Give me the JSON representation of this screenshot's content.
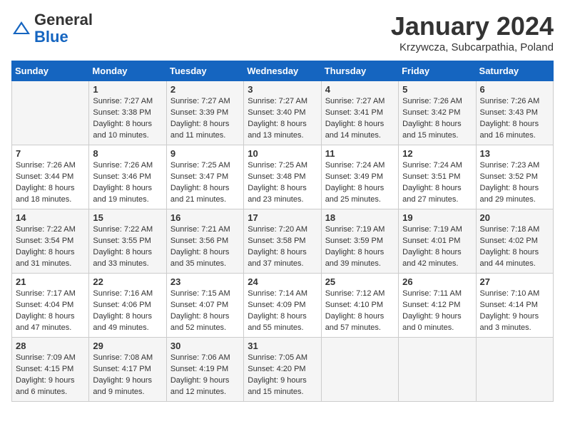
{
  "logo": {
    "general": "General",
    "blue": "Blue"
  },
  "header": {
    "month": "January 2024",
    "location": "Krzywcza, Subcarpathia, Poland"
  },
  "weekdays": [
    "Sunday",
    "Monday",
    "Tuesday",
    "Wednesday",
    "Thursday",
    "Friday",
    "Saturday"
  ],
  "weeks": [
    [
      {
        "day": "",
        "info": ""
      },
      {
        "day": "1",
        "info": "Sunrise: 7:27 AM\nSunset: 3:38 PM\nDaylight: 8 hours\nand 10 minutes."
      },
      {
        "day": "2",
        "info": "Sunrise: 7:27 AM\nSunset: 3:39 PM\nDaylight: 8 hours\nand 11 minutes."
      },
      {
        "day": "3",
        "info": "Sunrise: 7:27 AM\nSunset: 3:40 PM\nDaylight: 8 hours\nand 13 minutes."
      },
      {
        "day": "4",
        "info": "Sunrise: 7:27 AM\nSunset: 3:41 PM\nDaylight: 8 hours\nand 14 minutes."
      },
      {
        "day": "5",
        "info": "Sunrise: 7:26 AM\nSunset: 3:42 PM\nDaylight: 8 hours\nand 15 minutes."
      },
      {
        "day": "6",
        "info": "Sunrise: 7:26 AM\nSunset: 3:43 PM\nDaylight: 8 hours\nand 16 minutes."
      }
    ],
    [
      {
        "day": "7",
        "info": "Sunrise: 7:26 AM\nSunset: 3:44 PM\nDaylight: 8 hours\nand 18 minutes."
      },
      {
        "day": "8",
        "info": "Sunrise: 7:26 AM\nSunset: 3:46 PM\nDaylight: 8 hours\nand 19 minutes."
      },
      {
        "day": "9",
        "info": "Sunrise: 7:25 AM\nSunset: 3:47 PM\nDaylight: 8 hours\nand 21 minutes."
      },
      {
        "day": "10",
        "info": "Sunrise: 7:25 AM\nSunset: 3:48 PM\nDaylight: 8 hours\nand 23 minutes."
      },
      {
        "day": "11",
        "info": "Sunrise: 7:24 AM\nSunset: 3:49 PM\nDaylight: 8 hours\nand 25 minutes."
      },
      {
        "day": "12",
        "info": "Sunrise: 7:24 AM\nSunset: 3:51 PM\nDaylight: 8 hours\nand 27 minutes."
      },
      {
        "day": "13",
        "info": "Sunrise: 7:23 AM\nSunset: 3:52 PM\nDaylight: 8 hours\nand 29 minutes."
      }
    ],
    [
      {
        "day": "14",
        "info": "Sunrise: 7:22 AM\nSunset: 3:54 PM\nDaylight: 8 hours\nand 31 minutes."
      },
      {
        "day": "15",
        "info": "Sunrise: 7:22 AM\nSunset: 3:55 PM\nDaylight: 8 hours\nand 33 minutes."
      },
      {
        "day": "16",
        "info": "Sunrise: 7:21 AM\nSunset: 3:56 PM\nDaylight: 8 hours\nand 35 minutes."
      },
      {
        "day": "17",
        "info": "Sunrise: 7:20 AM\nSunset: 3:58 PM\nDaylight: 8 hours\nand 37 minutes."
      },
      {
        "day": "18",
        "info": "Sunrise: 7:19 AM\nSunset: 3:59 PM\nDaylight: 8 hours\nand 39 minutes."
      },
      {
        "day": "19",
        "info": "Sunrise: 7:19 AM\nSunset: 4:01 PM\nDaylight: 8 hours\nand 42 minutes."
      },
      {
        "day": "20",
        "info": "Sunrise: 7:18 AM\nSunset: 4:02 PM\nDaylight: 8 hours\nand 44 minutes."
      }
    ],
    [
      {
        "day": "21",
        "info": "Sunrise: 7:17 AM\nSunset: 4:04 PM\nDaylight: 8 hours\nand 47 minutes."
      },
      {
        "day": "22",
        "info": "Sunrise: 7:16 AM\nSunset: 4:06 PM\nDaylight: 8 hours\nand 49 minutes."
      },
      {
        "day": "23",
        "info": "Sunrise: 7:15 AM\nSunset: 4:07 PM\nDaylight: 8 hours\nand 52 minutes."
      },
      {
        "day": "24",
        "info": "Sunrise: 7:14 AM\nSunset: 4:09 PM\nDaylight: 8 hours\nand 55 minutes."
      },
      {
        "day": "25",
        "info": "Sunrise: 7:12 AM\nSunset: 4:10 PM\nDaylight: 8 hours\nand 57 minutes."
      },
      {
        "day": "26",
        "info": "Sunrise: 7:11 AM\nSunset: 4:12 PM\nDaylight: 9 hours\nand 0 minutes."
      },
      {
        "day": "27",
        "info": "Sunrise: 7:10 AM\nSunset: 4:14 PM\nDaylight: 9 hours\nand 3 minutes."
      }
    ],
    [
      {
        "day": "28",
        "info": "Sunrise: 7:09 AM\nSunset: 4:15 PM\nDaylight: 9 hours\nand 6 minutes."
      },
      {
        "day": "29",
        "info": "Sunrise: 7:08 AM\nSunset: 4:17 PM\nDaylight: 9 hours\nand 9 minutes."
      },
      {
        "day": "30",
        "info": "Sunrise: 7:06 AM\nSunset: 4:19 PM\nDaylight: 9 hours\nand 12 minutes."
      },
      {
        "day": "31",
        "info": "Sunrise: 7:05 AM\nSunset: 4:20 PM\nDaylight: 9 hours\nand 15 minutes."
      },
      {
        "day": "",
        "info": ""
      },
      {
        "day": "",
        "info": ""
      },
      {
        "day": "",
        "info": ""
      }
    ]
  ]
}
